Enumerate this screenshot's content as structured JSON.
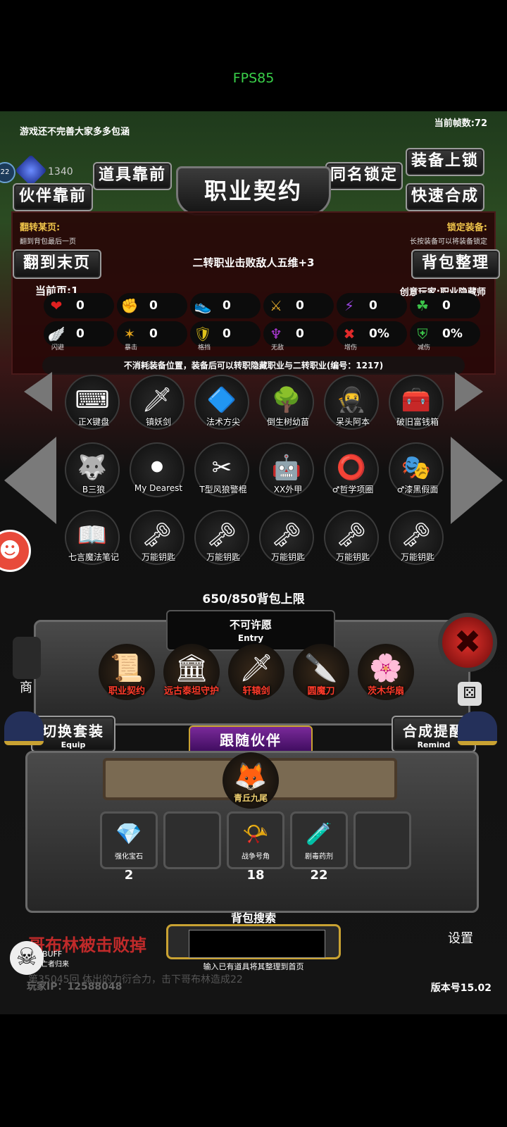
{
  "fps_overlay": "FPS85",
  "hud": {
    "notice": "游戏还不完善大家多多包涵",
    "frame_rate": "当前帧数:72",
    "gem_count": "1340",
    "level_badge": "22"
  },
  "buttons": {
    "items_front": "道具靠前",
    "partner_front": "伙伴靠前",
    "same_name_lock": "同名锁定",
    "quick_synth": "快速合成",
    "equip_lock": "装备上锁",
    "go_last_page": "翻到末页",
    "sort_bag": "背包整理"
  },
  "title": "职业契约",
  "panel": {
    "flip_label": "翻转某页:",
    "flip_hint": "翻到背包最后一页",
    "lock_label": "锁定装备:",
    "lock_hint": "长按装备可以将装备锁定",
    "desc": "二转职业击败敌人五维+3",
    "current_page": "当前页:1",
    "creator": "创意玩家:职业隐藏师",
    "footer_note": "不消耗装备位置，装备后可以转职隐藏职业与二转职业(编号：1217)"
  },
  "stats_row1": [
    {
      "icon": "❤",
      "color": "#e02020",
      "value": "0"
    },
    {
      "icon": "✊",
      "color": "#e0b21a",
      "value": "0"
    },
    {
      "icon": "👟",
      "color": "#3a8fe0",
      "value": "0"
    },
    {
      "icon": "⚔",
      "color": "#d9a22a",
      "value": "0"
    },
    {
      "icon": "⚡",
      "color": "#9a46e0",
      "value": "0"
    },
    {
      "icon": "☘",
      "color": "#3cc44a",
      "value": "0"
    }
  ],
  "stats_row2": [
    {
      "icon": "🪽",
      "color": "#3a8fe0",
      "value": "0",
      "label": "闪避"
    },
    {
      "icon": "✶",
      "color": "#e0a21a",
      "value": "0",
      "label": "暴击"
    },
    {
      "icon": "🛡",
      "color": "#e0c21a",
      "value": "0",
      "label": "格挡"
    },
    {
      "icon": "♆",
      "color": "#b03ad9",
      "value": "0",
      "label": "无敌"
    },
    {
      "icon": "✖",
      "color": "#e02a2a",
      "value": "0%",
      "label": "增伤"
    },
    {
      "icon": "⛨",
      "color": "#3cc44a",
      "value": "0%",
      "label": "减伤"
    }
  ],
  "inventory": [
    {
      "name": "正X键盘",
      "icon": "⌨"
    },
    {
      "name": "镇妖剑",
      "icon": "🗡"
    },
    {
      "name": "法术方尖",
      "icon": "🔷"
    },
    {
      "name": "倒生树幼苗",
      "icon": "🌳"
    },
    {
      "name": "呆头阿本",
      "icon": "🥷"
    },
    {
      "name": "破旧富钱箱",
      "icon": "🧰"
    },
    {
      "name": "B三狼",
      "icon": "🐺"
    },
    {
      "name": "My Dearest",
      "icon": "⚫"
    },
    {
      "name": "T型风狼警棍",
      "icon": "✂"
    },
    {
      "name": "XX外甲",
      "icon": "🤖"
    },
    {
      "name": "♂哲学项圈",
      "icon": "⭕"
    },
    {
      "name": "♂漆黑假面",
      "icon": "🎭"
    },
    {
      "name": "七言魔法笔记",
      "icon": "📖"
    },
    {
      "name": "万能钥匙",
      "icon": "🗝"
    },
    {
      "name": "万能钥匙",
      "icon": "🗝"
    },
    {
      "name": "万能钥匙",
      "icon": "🗝"
    },
    {
      "name": "万能钥匙",
      "icon": "🗝"
    },
    {
      "name": "万能钥匙",
      "icon": "🗝"
    }
  ],
  "bag_limit": "650/850背包上限",
  "entry": {
    "title": "不可许愿",
    "sub": "Entry"
  },
  "equipped": [
    {
      "name": "职业契约",
      "icon": "📜"
    },
    {
      "name": "远古泰坦守护",
      "icon": "🏛"
    },
    {
      "name": "轩辕剑",
      "icon": "🗡"
    },
    {
      "name": "圆魔刀",
      "icon": "🔪"
    },
    {
      "name": "茨木华扇",
      "icon": "🌸"
    }
  ],
  "switch_set": {
    "label": "切换套装",
    "sub": "Equip"
  },
  "synth_remind": {
    "label": "合成提醒",
    "sub": "Remind"
  },
  "follow_partner": "跟随伙伴",
  "partner": {
    "name": "青丘九尾",
    "icon": "🦊"
  },
  "consumables": [
    {
      "name": "强化宝石",
      "icon": "💎",
      "count": "2"
    },
    {
      "name": "",
      "icon": "",
      "count": ""
    },
    {
      "name": "战争号角",
      "icon": "📯",
      "count": "18"
    },
    {
      "name": "剧毒药剂",
      "icon": "🧪",
      "count": "22"
    },
    {
      "name": "",
      "icon": "",
      "count": ""
    }
  ],
  "search": {
    "title": "背包搜索",
    "hint": "输入已有道具将其整理到首页"
  },
  "side": {
    "shop": "商",
    "settings": "设置"
  },
  "ticker": "哥布林被击败掉",
  "ticker2": "第35045回 体出的力衍合力，击下哥布林造成22",
  "buff": {
    "label": "BUFF",
    "sub": "亡者归来"
  },
  "player_ip": "玩家IP：12588048",
  "version": "版本号15.02"
}
